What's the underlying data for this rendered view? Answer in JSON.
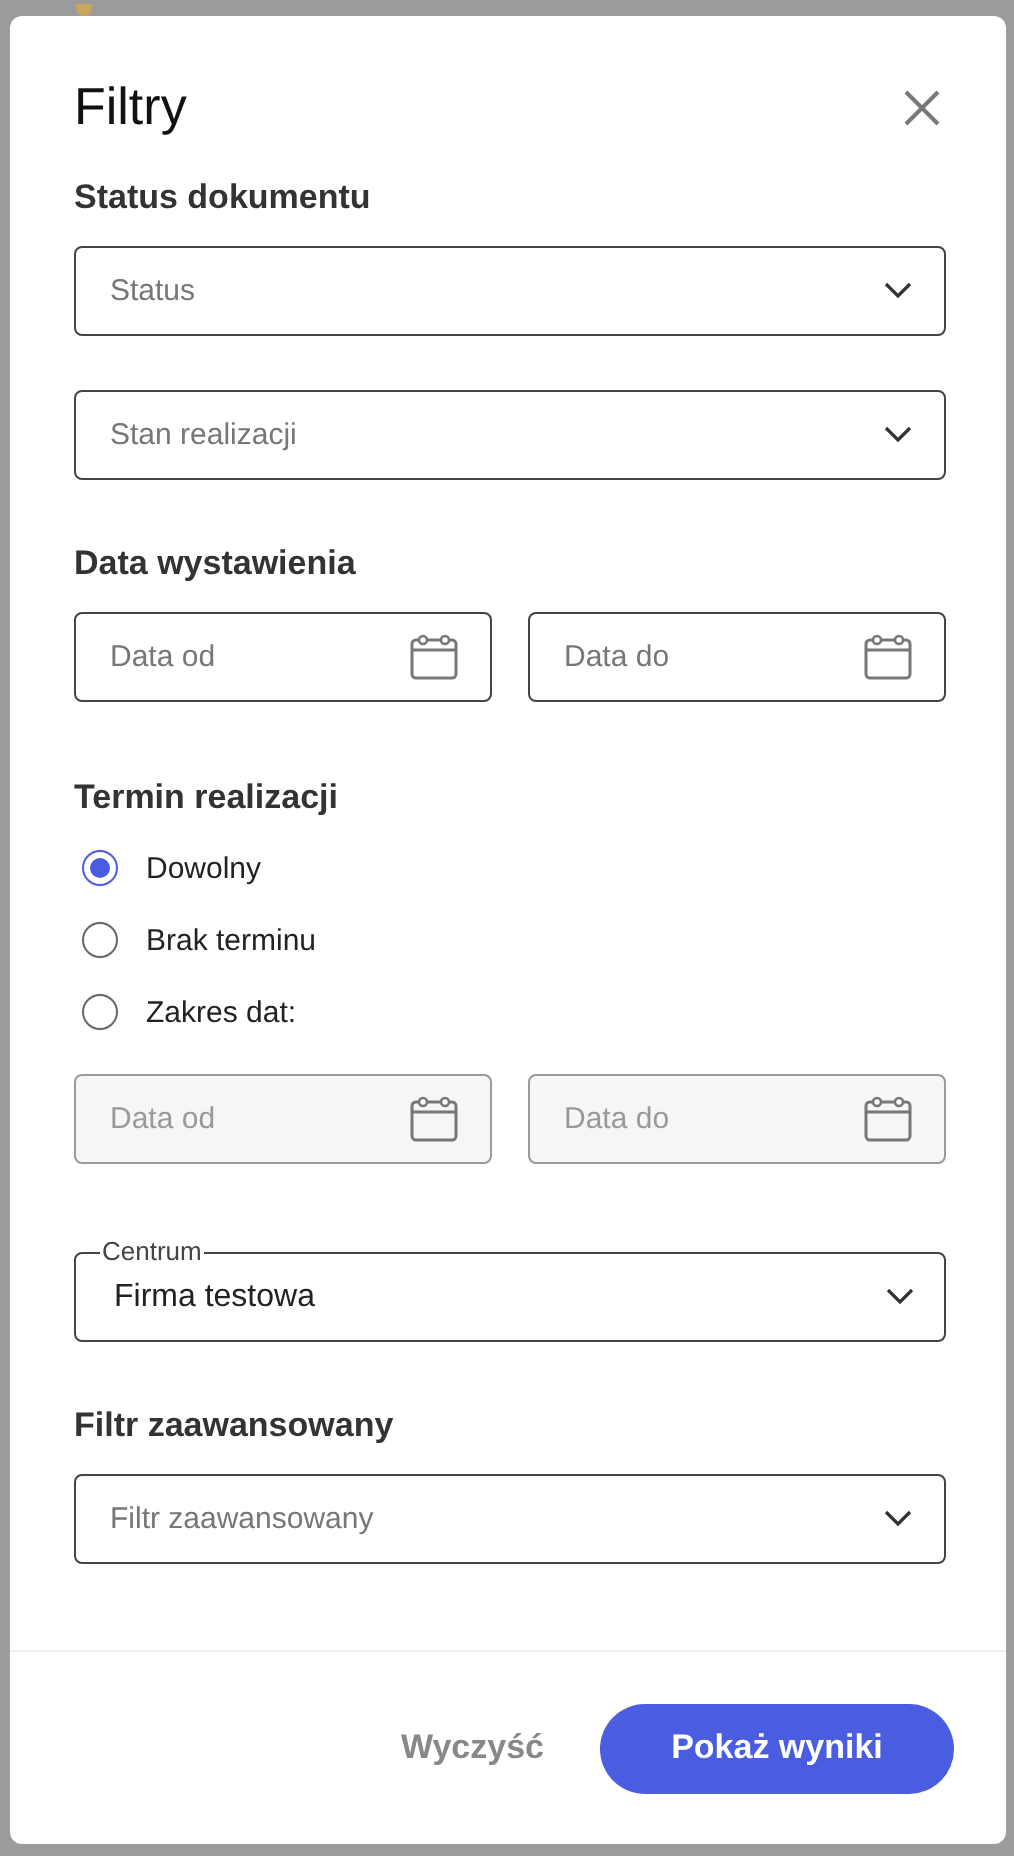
{
  "dialog": {
    "title": "Filtry",
    "sections": [
      {
        "kind": "selects",
        "heading": "Status dokumentu",
        "selects": [
          {
            "placeholder": "Status"
          },
          {
            "placeholder": "Stan realizacji"
          }
        ]
      },
      {
        "kind": "dates",
        "heading": "Data wystawienia",
        "dates": [
          {
            "placeholder": "Data od",
            "disabled": false
          },
          {
            "placeholder": "Data do",
            "disabled": false
          }
        ]
      },
      {
        "kind": "radios",
        "heading": "Termin realizacji",
        "options": [
          {
            "label": "Dowolny",
            "selected": true
          },
          {
            "label": "Brak terminu",
            "selected": false
          },
          {
            "label": "Zakres dat:",
            "selected": false
          }
        ],
        "dates": [
          {
            "placeholder": "Data od",
            "disabled": true
          },
          {
            "placeholder": "Data do",
            "disabled": true
          }
        ]
      },
      {
        "kind": "outlined",
        "label": "Centrum",
        "value": "Firma testowa"
      },
      {
        "kind": "selects",
        "heading": "Filtr zaawansowany",
        "selects": [
          {
            "placeholder": "Filtr zaawansowany"
          }
        ]
      }
    ],
    "buttons": {
      "clear": "Wyczyść",
      "submit": "Pokaż wyniki"
    }
  }
}
